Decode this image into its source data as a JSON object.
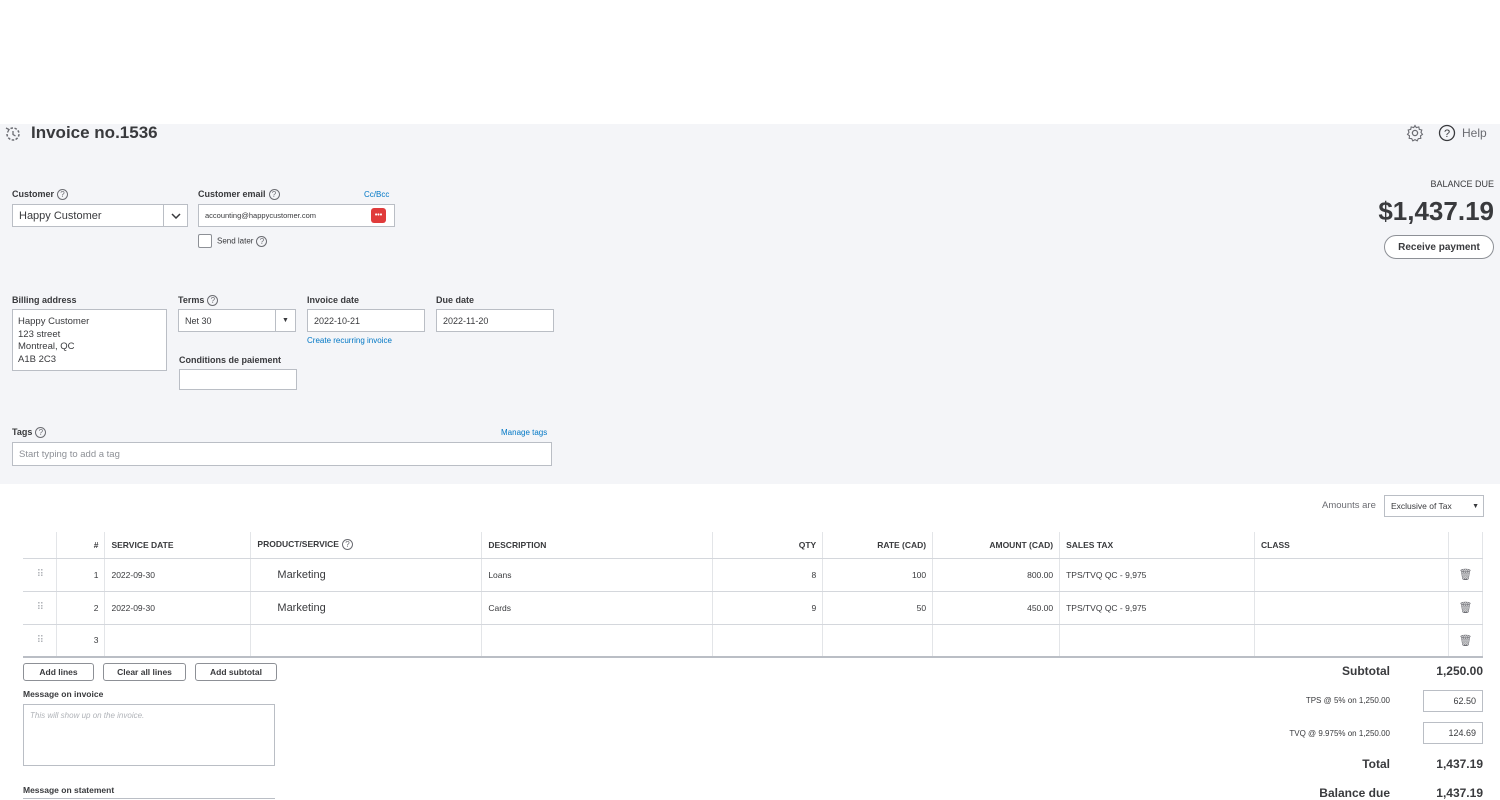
{
  "header": {
    "title": "Invoice no.1536",
    "help_label": "Help",
    "balance_due_label": "BALANCE DUE",
    "balance_due_amount": "$1,437.19",
    "receive_payment_label": "Receive payment"
  },
  "form": {
    "customer_label": "Customer",
    "customer_value": "Happy Customer",
    "customer_email_label": "Customer email",
    "cc_bcc_label": "Cc/Bcc",
    "customer_email_value": "accounting@happycustomer.com",
    "send_later_label": "Send later",
    "billing_address_label": "Billing address",
    "billing_address_lines": [
      "Happy Customer",
      "123 street",
      "Montreal, QC",
      "A1B 2C3"
    ],
    "terms_label": "Terms",
    "terms_value": "Net 30",
    "invoice_date_label": "Invoice date",
    "invoice_date_value": "2022-10-21",
    "due_date_label": "Due date",
    "due_date_value": "2022-11-20",
    "create_recurring_label": "Create recurring invoice",
    "conditions_label": "Conditions de paiement",
    "conditions_value": "",
    "tags_label": "Tags",
    "manage_tags_label": "Manage tags",
    "tags_placeholder": "Start typing to add a tag"
  },
  "amounts_are_label": "Amounts are",
  "amounts_are_value": "Exclusive of Tax",
  "table": {
    "headers": {
      "num": "#",
      "service_date": "SERVICE DATE",
      "product": "PRODUCT/SERVICE",
      "description": "DESCRIPTION",
      "qty": "QTY",
      "rate": "RATE (CAD)",
      "amount": "AMOUNT (CAD)",
      "sales_tax": "SALES TAX",
      "class": "CLASS"
    },
    "rows": [
      {
        "num": "1",
        "service_date": "2022-09-30",
        "product": "Marketing",
        "description": "Loans",
        "qty": "8",
        "rate": "100",
        "amount": "800.00",
        "sales_tax": "TPS/TVQ QC - 9,975",
        "class": ""
      },
      {
        "num": "2",
        "service_date": "2022-09-30",
        "product": "Marketing",
        "description": "Cards",
        "qty": "9",
        "rate": "50",
        "amount": "450.00",
        "sales_tax": "TPS/TVQ QC - 9,975",
        "class": ""
      },
      {
        "num": "3",
        "service_date": "",
        "product": "",
        "description": "",
        "qty": "",
        "rate": "",
        "amount": "",
        "sales_tax": "",
        "class": ""
      }
    ]
  },
  "buttons": {
    "add_lines": "Add lines",
    "clear_all_lines": "Clear all lines",
    "add_subtotal": "Add subtotal"
  },
  "message_invoice_label": "Message on invoice",
  "message_invoice_placeholder": "This will show up on the invoice.",
  "message_statement_label": "Message on statement",
  "totals": {
    "subtotal_label": "Subtotal",
    "subtotal_value": "1,250.00",
    "tps_label": "TPS @ 5% on 1,250.00",
    "tps_value": "62.50",
    "tvq_label": "TVQ @ 9.975% on 1,250.00",
    "tvq_value": "124.69",
    "total_label": "Total",
    "total_value": "1,437.19",
    "balance_due_label": "Balance due",
    "balance_due_value": "1,437.19"
  }
}
